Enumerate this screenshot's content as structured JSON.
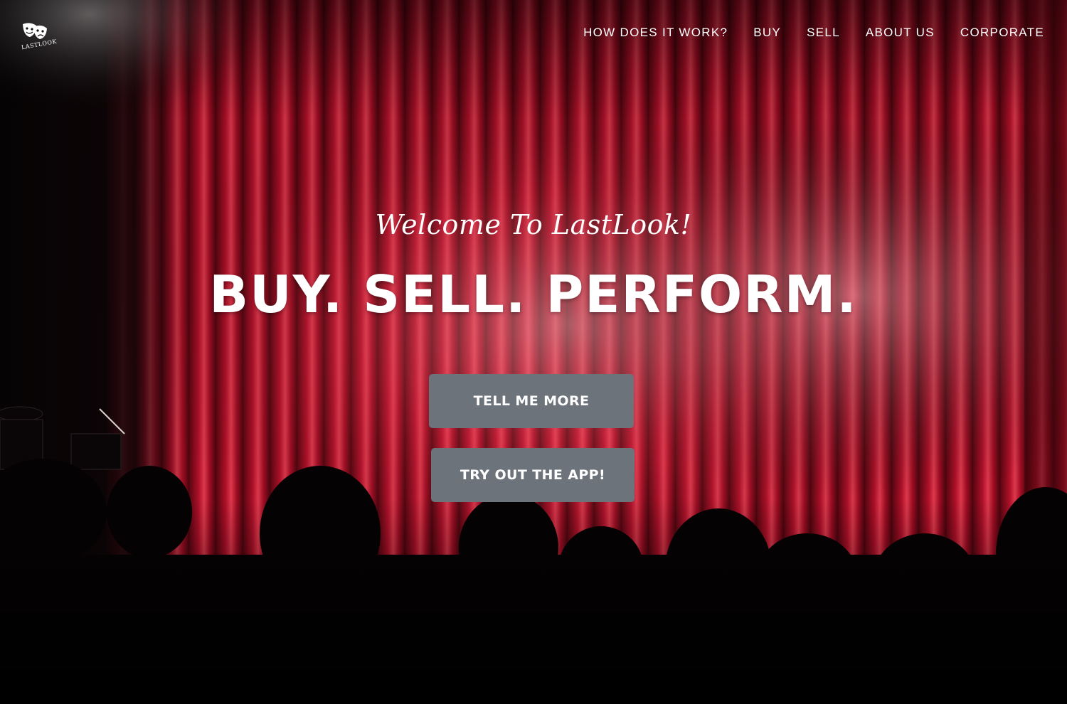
{
  "brand": {
    "logo_text": "LASTLOOK",
    "logo_icon": "theater-masks-icon"
  },
  "nav": {
    "items": [
      {
        "label": "HOW DOES IT WORK?"
      },
      {
        "label": "BUY"
      },
      {
        "label": "SELL"
      },
      {
        "label": "ABOUT US"
      },
      {
        "label": "CORPORATE"
      }
    ]
  },
  "hero": {
    "welcome": "Welcome To LastLook!",
    "headline": "BUY. SELL. PERFORM.",
    "primary_button": "TELL ME MORE",
    "secondary_button": "TRY OUT THE APP!"
  },
  "colors": {
    "curtain_red": "#c8102e",
    "button_gray": "#6c737b",
    "text_white": "#ffffff"
  }
}
